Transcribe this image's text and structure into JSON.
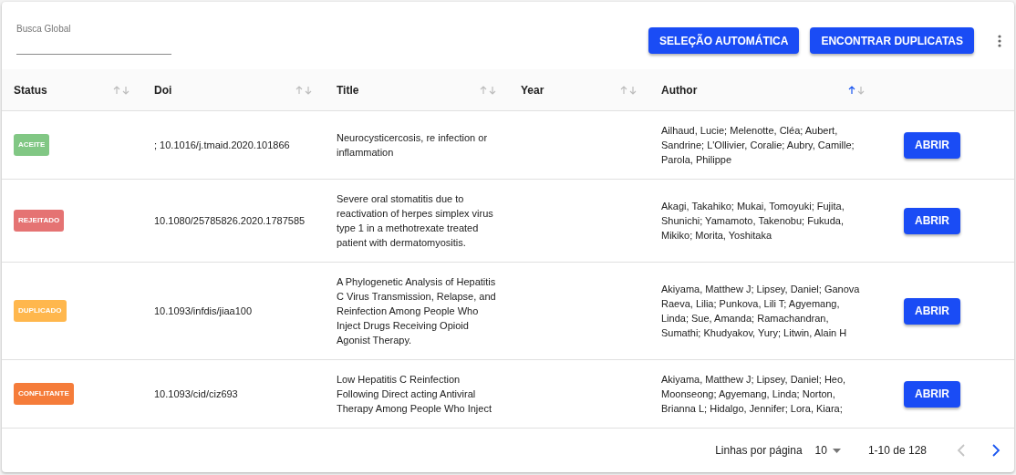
{
  "search": {
    "label": "Busca Global"
  },
  "actions": [
    "SELEÇÃO AUTOMÁTICA",
    "ENCONTRAR DUPLICATAS"
  ],
  "table": {
    "columns": [
      {
        "label": "Status",
        "sorted_ascending": false
      },
      {
        "label": "Doi",
        "sorted_ascending": false
      },
      {
        "label": "Title",
        "sorted_ascending": false
      },
      {
        "label": "Year",
        "sorted_ascending": false
      },
      {
        "label": "Author",
        "sorted_ascending": true
      }
    ],
    "rows": [
      {
        "status": "ACEITE",
        "color": "#81c784",
        "doi": "; 10.1016/j.tmaid.2020.101866",
        "title": "Neurocysticercosis, re infection or inflammation",
        "author": "Ailhaud, Lucie; Melenotte, Cléa; Aubert, Sandrine; L'Ollivier, Coralie; Aubry, Camille; Parola, Philippe",
        "action": "ABRIR"
      },
      {
        "status": "REJEITADO",
        "color": "#e57373",
        "doi": "10.1080/25785826.2020.1787585",
        "title": "Severe oral stomatitis due to reactivation of herpes simplex virus type 1 in a methotrexate treated patient with dermatomyositis.",
        "author": "Akagi, Takahiko; Mukai, Tomoyuki; Fujita, Shunichi; Yamamoto, Takenobu; Fukuda, Mikiko; Morita, Yoshitaka",
        "action": "ABRIR"
      },
      {
        "status": "DUPLICADO",
        "color": "#ffb74d",
        "doi": "10.1093/infdis/jiaa100",
        "title": "A Phylogenetic Analysis of Hepatitis C Virus Transmission, Relapse, and Reinfection Among People Who Inject Drugs Receiving Opioid Agonist Therapy.",
        "author": "Akiyama, Matthew J; Lipsey, Daniel; Ganova Raeva, Lilia; Punkova, Lili T; Agyemang, Linda; Sue, Amanda; Ramachandran, Sumathi; Khudyakov, Yury; Litwin, Alain H",
        "action": "ABRIR"
      },
      {
        "status": "CONFLITANTE",
        "color": "#f57c3a",
        "doi": "10.1093/cid/ciz693",
        "title": "Low Hepatitis C Reinfection Following Direct acting Antiviral Therapy Among People Who Inject",
        "author": "Akiyama, Matthew J; Lipsey, Daniel; Heo, Moonseong; Agyemang, Linda; Norton, Brianna L; Hidalgo, Jennifer; Lora, Kiara;",
        "action": "ABRIR"
      }
    ]
  },
  "pagination": {
    "rows_label": "Linhas por página",
    "rows_value": "10",
    "range": "1-10 de 128",
    "prev_disabled": true,
    "next_disabled": false
  }
}
